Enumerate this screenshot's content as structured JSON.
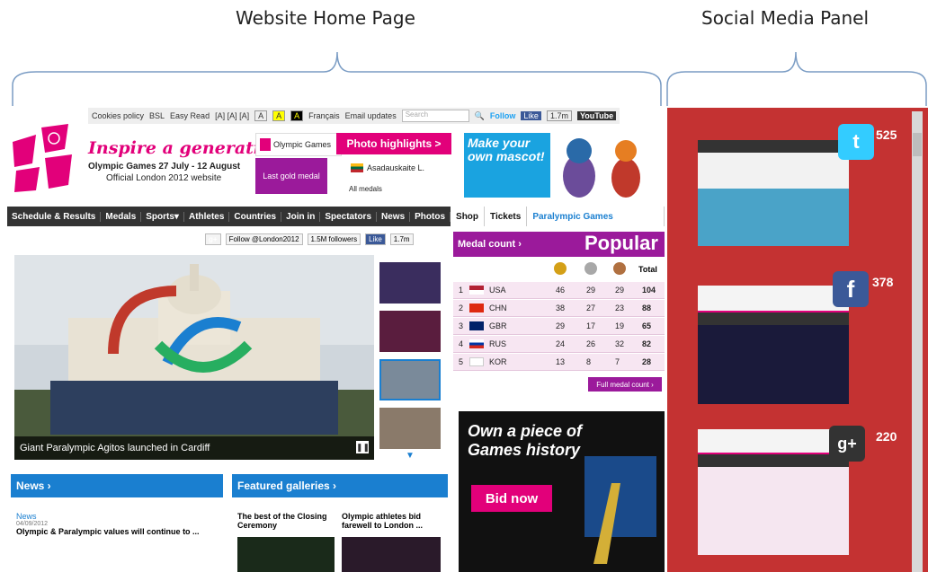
{
  "captions": {
    "left": "Website Home Page",
    "right": "Social Media Panel"
  },
  "utility_bar": {
    "cookies": "Cookies policy",
    "bsl": "BSL",
    "easy_read": "Easy Read",
    "text_sizes": "[A] [A] [A]",
    "contrast_a": "A",
    "contrast_b": "A",
    "contrast_c": "A",
    "francais": "Français",
    "email": "Email updates",
    "search_placeholder": "Search",
    "follow": "Follow",
    "like": "Like",
    "like_count": "1.7m",
    "youtube": "YouTube"
  },
  "header": {
    "tagline": "Inspire a generation",
    "dates": "Olympic Games 27 July - 12 August",
    "official": "Official London 2012 website",
    "olympic_games": "Olympic Games",
    "photo_highlights": "Photo highlights >",
    "last_gold": "Last gold medal",
    "gold_name": "Asadauskaite L.",
    "all_medals": "All medals",
    "mascot_ad": "Make your own mascot!"
  },
  "nav": {
    "items": [
      "Schedule & Results",
      "Medals",
      "Sports▾",
      "Athletes",
      "Countries",
      "Join in",
      "Spectators",
      "News",
      "Photos"
    ],
    "shop": "Shop",
    "tickets": "Tickets",
    "paralympic": "Paralympic Games"
  },
  "social_row": {
    "gplus": "g+",
    "follow": "Follow @London2012",
    "followers": "1.5M followers",
    "like": "Like",
    "like_count": "1.7m"
  },
  "hero": {
    "caption": "Giant Paralympic Agitos launched in Cardiff"
  },
  "medal_table": {
    "title": "Medal count ›",
    "banner": "Popular",
    "total_header": "Total",
    "rows": [
      {
        "rank": "1",
        "country": "USA",
        "gold": "46",
        "silver": "29",
        "bronze": "29",
        "total": "104"
      },
      {
        "rank": "2",
        "country": "CHN",
        "gold": "38",
        "silver": "27",
        "bronze": "23",
        "total": "88"
      },
      {
        "rank": "3",
        "country": "GBR",
        "gold": "29",
        "silver": "17",
        "bronze": "19",
        "total": "65"
      },
      {
        "rank": "4",
        "country": "RUS",
        "gold": "24",
        "silver": "26",
        "bronze": "32",
        "total": "82"
      },
      {
        "rank": "5",
        "country": "KOR",
        "gold": "13",
        "silver": "8",
        "bronze": "7",
        "total": "28"
      }
    ],
    "full_link": "Full medal count ›"
  },
  "news": {
    "title": "News ›",
    "label": "News",
    "date": "04/09/2012",
    "headline": "Olympic & Paralympic values will continue to ..."
  },
  "galleries": {
    "title": "Featured galleries ›",
    "item1": "The best of the Closing Ceremony",
    "item2": "Olympic athletes bid farewell to London ..."
  },
  "ad": {
    "text": "Own a piece of Games history",
    "button": "Bid now"
  },
  "social_panel": {
    "twitter_count": "525",
    "facebook_count": "378",
    "gplus_count": "220"
  }
}
